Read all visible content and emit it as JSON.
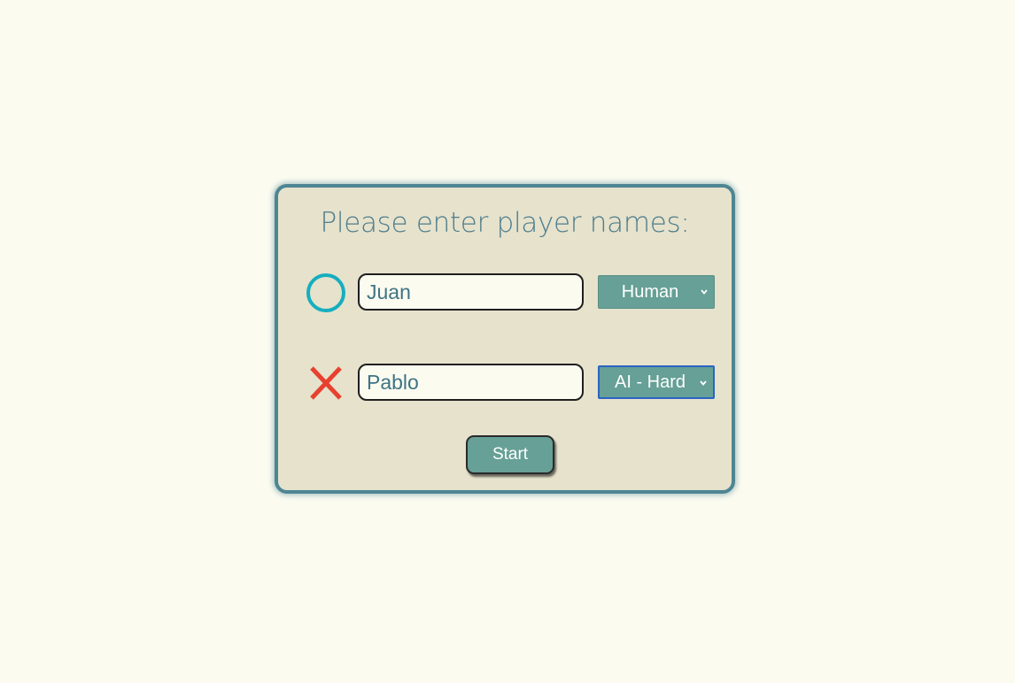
{
  "dialog": {
    "title": "Please enter player names:"
  },
  "players": [
    {
      "mark_icon": "circle-o-icon",
      "name_value": "Juan",
      "type_selected": "Human",
      "mark_color": "#16aebf"
    },
    {
      "mark_icon": "cross-x-icon",
      "name_value": "Pablo",
      "type_selected": "AI - Hard",
      "mark_color": "#e8412f"
    }
  ],
  "start_label": "Start",
  "colors": {
    "background": "#fbfbf0",
    "panel": "#e6e2cc",
    "panel_border": "#4e8593",
    "accent": "#66a096",
    "title_text": "#4e7d8c",
    "focus_ring": "#2a63c4"
  }
}
